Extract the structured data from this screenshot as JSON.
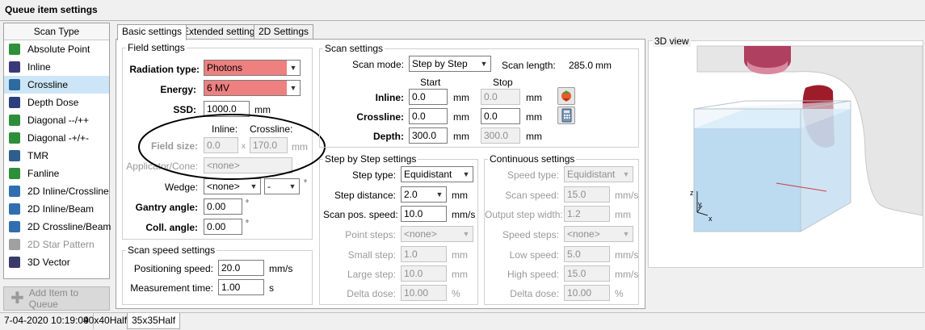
{
  "window": {
    "title": "Queue item settings"
  },
  "scan_type": {
    "header": "Scan Type",
    "items": [
      {
        "label": "Absolute Point",
        "icon": "absolute-point-icon",
        "color": "#2f8f3a"
      },
      {
        "label": "Inline",
        "icon": "inline-icon",
        "color": "#3a3a7a"
      },
      {
        "label": "Crossline",
        "icon": "crossline-icon",
        "color": "#2d6b9e",
        "selected": true
      },
      {
        "label": "Depth Dose",
        "icon": "depth-dose-icon",
        "color": "#2d3e7e"
      },
      {
        "label": "Diagonal --/++",
        "icon": "diagonal-icon",
        "color": "#2e8f3a"
      },
      {
        "label": "Diagonal -+/+-",
        "icon": "diagonal-icon",
        "color": "#2e8f3a"
      },
      {
        "label": "TMR",
        "icon": "tmr-icon",
        "color": "#2d5f8e"
      },
      {
        "label": "Fanline",
        "icon": "fanline-icon",
        "color": "#2e8f3a"
      },
      {
        "label": "2D Inline/Crossline",
        "icon": "2d-icon",
        "color": "#2f6fb0"
      },
      {
        "label": "2D Inline/Beam",
        "icon": "2d-icon",
        "color": "#2f6fb0"
      },
      {
        "label": "2D Crossline/Beam",
        "icon": "2d-icon",
        "color": "#2f6fb0"
      },
      {
        "label": "2D Star Pattern",
        "icon": "star-pattern-icon",
        "color": "#a0a0a0",
        "disabled": true
      },
      {
        "label": "3D Vector",
        "icon": "3d-vector-icon",
        "color": "#3a3a6a"
      }
    ],
    "add_button": "Add Item to Queue"
  },
  "tabs": [
    "Basic settings",
    "Extended settings",
    "2D Settings"
  ],
  "field_settings": {
    "legend": "Field settings",
    "radiation_type_label": "Radiation type:",
    "radiation_type_value": "Photons",
    "energy_label": "Energy:",
    "energy_value": "6 MV",
    "ssd_label": "SSD:",
    "ssd_value": "1000.0",
    "ssd_unit": "mm",
    "inline_hdr": "Inline:",
    "crossline_hdr": "Crossline:",
    "field_size_label": "Field size:",
    "field_size_inline": "0.0",
    "field_size_x": "x",
    "field_size_crossline": "170.0",
    "field_size_unit": "mm",
    "applicator_label": "Applicator/Cone:",
    "applicator_value": "<none>",
    "wedge_label": "Wedge:",
    "wedge_value": "<none>",
    "wedge_dir": "-",
    "wedge_deg": "°",
    "gantry_label": "Gantry angle:",
    "gantry_value": "0.00",
    "gantry_deg": "°",
    "coll_label": "Coll. angle:",
    "coll_value": "0.00",
    "coll_deg": "°"
  },
  "scan_speed": {
    "legend": "Scan speed settings",
    "positioning_label": "Positioning speed:",
    "positioning_value": "20.0",
    "positioning_unit": "mm/s",
    "measurement_label": "Measurement time:",
    "measurement_value": "1.00",
    "measurement_unit": "s"
  },
  "scan_settings": {
    "legend": "Scan settings",
    "mode_label": "Scan mode:",
    "mode_value": "Step by Step",
    "length_label": "Scan length:",
    "length_value": "285.0",
    "length_unit": "mm",
    "start_hdr": "Start",
    "stop_hdr": "Stop",
    "inline_label": "Inline:",
    "inline_start": "0.0",
    "inline_stop": "0.0",
    "crossline_label": "Crossline:",
    "crossline_start": "0.0",
    "crossline_stop": "0.0",
    "depth_label": "Depth:",
    "depth_start": "300.0",
    "depth_stop": "300.0",
    "unit": "mm"
  },
  "step_settings": {
    "legend": "Step by Step settings",
    "step_type_label": "Step type:",
    "step_type_value": "Equidistant",
    "step_distance_label": "Step distance:",
    "step_distance_value": "2.0",
    "step_distance_unit": "mm",
    "scan_pos_label": "Scan pos. speed:",
    "scan_pos_value": "10.0",
    "scan_pos_unit": "mm/s",
    "point_steps_label": "Point steps:",
    "point_steps_value": "<none>",
    "small_step_label": "Small step:",
    "small_step_value": "1.0",
    "small_step_unit": "mm",
    "large_step_label": "Large step:",
    "large_step_value": "10.0",
    "large_step_unit": "mm",
    "delta_dose_label": "Delta dose:",
    "delta_dose_value": "10.00",
    "delta_dose_unit": "%"
  },
  "continuous_settings": {
    "legend": "Continuous settings",
    "speed_type_label": "Speed type:",
    "speed_type_value": "Equidistant",
    "scan_speed_label": "Scan speed:",
    "scan_speed_value": "15.0",
    "scan_speed_unit": "mm/s",
    "output_step_label": "Output step width:",
    "output_step_value": "1.2",
    "output_step_unit": "mm",
    "speed_steps_label": "Speed steps:",
    "speed_steps_value": "<none>",
    "low_speed_label": "Low speed:",
    "low_speed_value": "5.0",
    "low_speed_unit": "mm/s",
    "high_speed_label": "High speed:",
    "high_speed_value": "15.0",
    "high_speed_unit": "mm/s",
    "delta_dose_label": "Delta dose:",
    "delta_dose_value": "10.00",
    "delta_dose_unit": "%"
  },
  "view3d": {
    "label": "3D view",
    "axis_z": "z",
    "axis_y": "y",
    "axis_x": "x"
  },
  "status_bar": {
    "tabs": [
      "7-04-2020 10:19:09",
      "40x40Half",
      "35x35Half"
    ],
    "active_index": 2
  }
}
